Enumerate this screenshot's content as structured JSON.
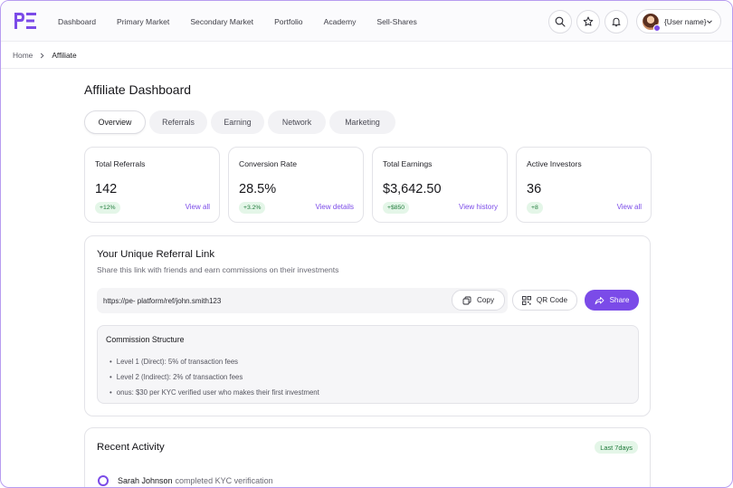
{
  "header": {
    "logo_text": "PE",
    "nav": [
      "Dashboard",
      "Primary Market",
      "Secondary Market",
      "Portfolio",
      "Academy",
      "Sell-Shares"
    ],
    "user_name": "{User name}"
  },
  "breadcrumb": {
    "home": "Home",
    "current": "Affiliate"
  },
  "page": {
    "title": "Affiliate Dashboard",
    "tabs": [
      "Overview",
      "Referrals",
      "Earning",
      "Network",
      "Marketing"
    ],
    "active_tab": "Overview"
  },
  "stats": [
    {
      "label": "Total Referrals",
      "value": "142",
      "delta": "+12%",
      "link": "View all"
    },
    {
      "label": "Conversion Rate",
      "value": "28.5%",
      "delta": "+3.2%",
      "link": "View details"
    },
    {
      "label": "Total Earnings",
      "value": "$3,642.50",
      "delta": "+$850",
      "link": "View history"
    },
    {
      "label": "Active Investors",
      "value": "36",
      "delta": "+8",
      "link": "View all"
    }
  ],
  "referral": {
    "title": "Your Unique Referral Link",
    "subtitle": "Share this link with friends and earn commissions on their investments",
    "link": "https://pe- platform/ref/john.smith123",
    "copy_label": "Copy",
    "qr_label": "QR Code",
    "share_label": "Share",
    "commission": {
      "title": "Commission Structure",
      "items": [
        "Level 1 (Direct): 5% of transaction fees",
        "Level 2 (Indirect): 2% of transaction fees",
        "onus: $30 per KYC verified user who makes their first investment"
      ]
    }
  },
  "activity": {
    "title": "Recent Activity",
    "filter": "Last 7days",
    "items": [
      {
        "name": "Sarah Johnson",
        "text": "completed KYC verification"
      }
    ]
  },
  "colors": {
    "accent": "#7b4be8",
    "positive_bg": "#e4f6e8",
    "positive_text": "#1f7a3a"
  }
}
